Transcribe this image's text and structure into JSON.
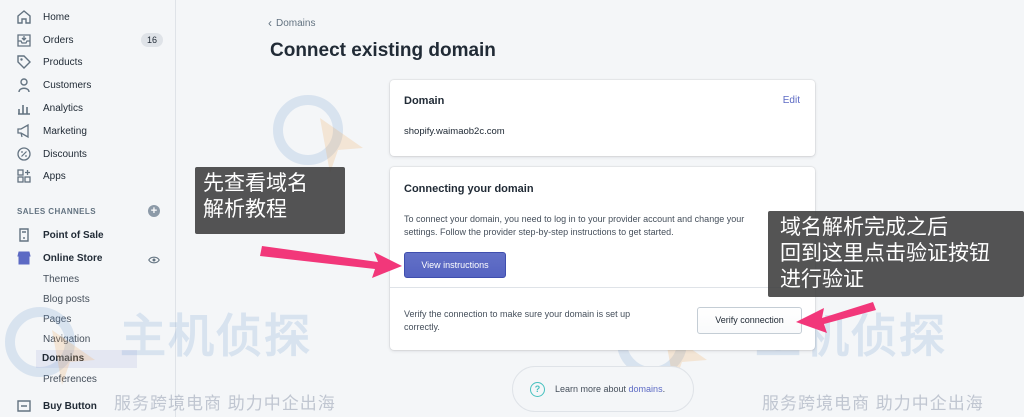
{
  "sidebar": {
    "items": [
      {
        "label": "Home",
        "icon": "home-icon"
      },
      {
        "label": "Orders",
        "icon": "orders-icon",
        "badge": "16"
      },
      {
        "label": "Products",
        "icon": "tag-icon"
      },
      {
        "label": "Customers",
        "icon": "person-icon"
      },
      {
        "label": "Analytics",
        "icon": "bar-chart-icon"
      },
      {
        "label": "Marketing",
        "icon": "megaphone-icon"
      },
      {
        "label": "Discounts",
        "icon": "discount-icon"
      },
      {
        "label": "Apps",
        "icon": "apps-icon"
      }
    ],
    "sales_channels_heading": "SALES CHANNELS",
    "channels": [
      {
        "label": "Point of Sale",
        "icon": "store-icon"
      },
      {
        "label": "Online Store",
        "icon": "online-store-icon"
      }
    ],
    "online_store_sub": [
      "Themes",
      "Blog posts",
      "Pages",
      "Navigation",
      "Domains",
      "Preferences"
    ],
    "buy_button": {
      "label": "Buy Button",
      "icon": "buy-button-icon"
    }
  },
  "main": {
    "breadcrumb": "Domains",
    "title": "Connect existing domain",
    "domain_card": {
      "title": "Domain",
      "edit_label": "Edit",
      "value": "shopify.waimaob2c.com"
    },
    "connect_card": {
      "title": "Connecting your domain",
      "description_line1": "To connect your domain, you need to log in to your provider account and change your",
      "description_line2": "settings. Follow the provider step-by-step instructions to get started.",
      "view_button": "View instructions",
      "verify_text_line1": "Verify the connection to make sure your domain is set up",
      "verify_text_line2": "correctly.",
      "verify_button": "Verify connection"
    },
    "help": {
      "prefix": "Learn more about ",
      "link": "domains",
      "suffix": "."
    }
  },
  "annotations": {
    "left_line1": "先查看域名",
    "left_line2": "解析教程",
    "right_line1": "域名解析完成之后",
    "right_line2": "回到这里点击验证按钮",
    "right_line3": "进行验证"
  },
  "watermark": {
    "big": "主机侦探",
    "small": "服务跨境电商  助力中企出海"
  },
  "colors": {
    "primary": "#5c6ac4",
    "arrow": "#f2377a",
    "teal": "#47c1bf"
  }
}
